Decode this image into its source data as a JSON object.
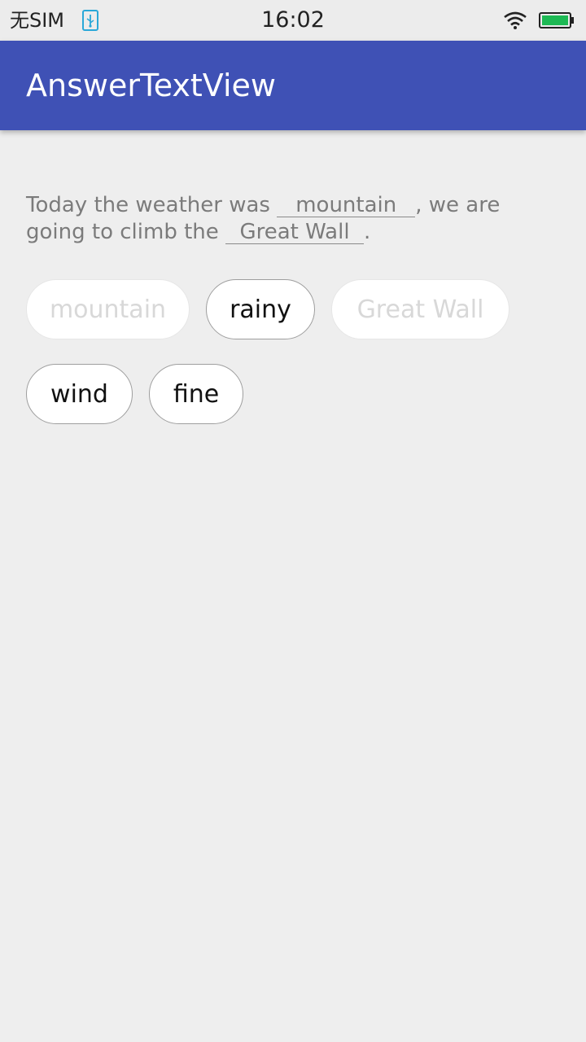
{
  "status_bar": {
    "carrier": "无SIM",
    "time": "16:02",
    "icons": [
      "usb-icon",
      "wifi-icon",
      "battery-icon"
    ],
    "battery_color": "#1db954"
  },
  "app_bar": {
    "title": "AnswerTextView",
    "color": "#3f51b5"
  },
  "sentence": {
    "part1": "Today the weather was ",
    "blank1": "mountain",
    "part2": ", we are going to climb the ",
    "blank2": "Great Wall",
    "part3": "."
  },
  "options": [
    {
      "label": "mountain",
      "used": true
    },
    {
      "label": "rainy",
      "used": false
    },
    {
      "label": "Great Wall",
      "used": true
    },
    {
      "label": "wind",
      "used": false
    },
    {
      "label": "fine",
      "used": false
    }
  ]
}
